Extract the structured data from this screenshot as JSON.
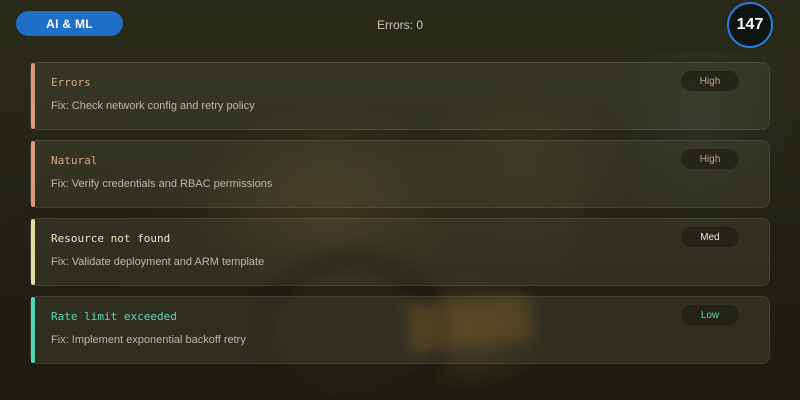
{
  "header": {
    "category_label": "AI & ML",
    "status_text": "Errors: 0",
    "counter": "147"
  },
  "colors": {
    "pill": "#1f6ec8",
    "counter_ring": "#2a7de0",
    "error_accent": "#d89a7a",
    "natural_accent": "#d89a7a",
    "notfound_accent": "#e3dca0",
    "ratelimit_accent": "#4fd6b4"
  },
  "cards": [
    {
      "title": "Errors",
      "fix": "Fix: Check network config and retry policy",
      "severity": "High"
    },
    {
      "title": "Natural",
      "fix": "Fix: Verify credentials and RBAC permissions",
      "severity": "High"
    },
    {
      "title": "Resource not found",
      "fix": "Fix: Validate deployment and ARM template",
      "severity": "Med"
    },
    {
      "title": "Rate limit exceeded",
      "fix": "Fix: Implement exponential backoff retry",
      "severity": "Low"
    }
  ]
}
